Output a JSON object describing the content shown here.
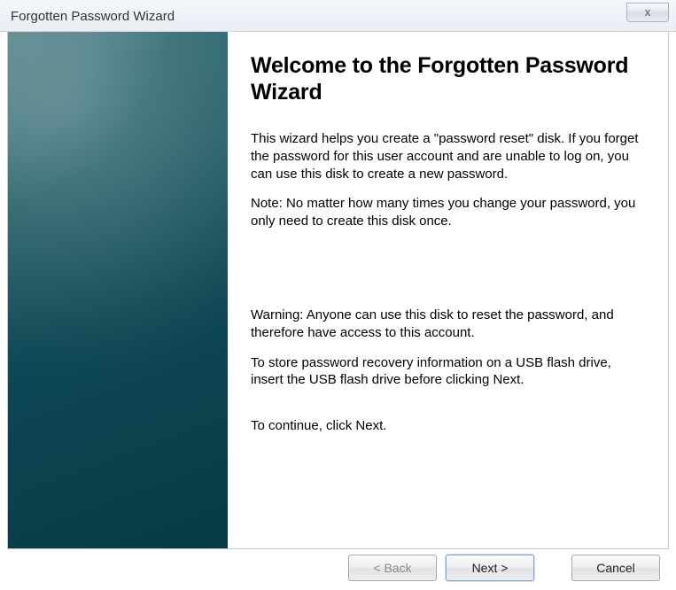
{
  "titlebar": {
    "title": "Forgotten Password Wizard",
    "close_label": "x"
  },
  "wizard": {
    "heading": "Welcome to the Forgotten Password Wizard",
    "intro": "This wizard helps you create a \"password reset\" disk. If you forget the password for this user account and are unable to log on, you can use this disk to create a new password.",
    "note": "Note: No matter how many times you change your password, you only need to create this disk once.",
    "warning": "Warning: Anyone can use this disk to reset the password, and therefore have access to this account.",
    "usb_hint": "To store password recovery information on a USB flash drive, insert the USB flash drive before clicking Next.",
    "continue_hint": "To continue, click Next."
  },
  "buttons": {
    "back": "< Back",
    "next": "Next >",
    "cancel": "Cancel"
  }
}
